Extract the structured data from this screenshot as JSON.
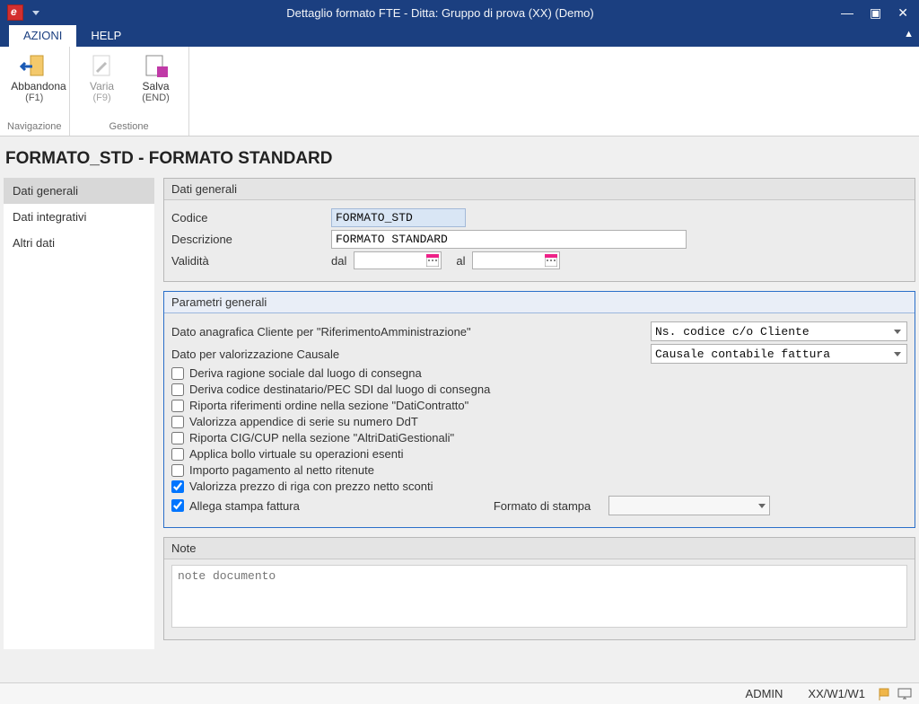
{
  "window": {
    "title": "Dettaglio formato FTE - Ditta: Gruppo di prova (XX)  (Demo)"
  },
  "tabs": {
    "azioni": "AZIONI",
    "help": "HELP"
  },
  "ribbon": {
    "abbandona_label": "Abbandona",
    "abbandona_sub": "(F1)",
    "varia_label": "Varia",
    "varia_sub": "(F9)",
    "salva_label": "Salva",
    "salva_sub": "(END)",
    "group_nav": "Navigazione",
    "group_gest": "Gestione"
  },
  "page_heading": "FORMATO_STD - FORMATO STANDARD",
  "sidenav": {
    "dati_generali": "Dati generali",
    "dati_integrativi": "Dati integrativi",
    "altri_dati": "Altri dati"
  },
  "panel_general": {
    "title": "Dati generali",
    "codice_label": "Codice",
    "codice_value": "FORMATO_STD",
    "descrizione_label": "Descrizione",
    "descrizione_value": "FORMATO STANDARD",
    "validita_label": "Validità",
    "dal_label": "dal",
    "al_label": "al"
  },
  "panel_param": {
    "title": "Parametri generali",
    "row_rif_label": "Dato anagrafica Cliente per \"RiferimentoAmministrazione\"",
    "row_rif_select": "Ns. codice c/o Cliente",
    "row_causale_label": "Dato per valorizzazione Causale",
    "row_causale_select": "Causale contabile fattura",
    "chk1": "Deriva ragione sociale dal luogo di consegna",
    "chk2": "Deriva codice destinatario/PEC SDI dal luogo di consegna",
    "chk3": "Riporta riferimenti ordine nella sezione \"DatiContratto\"",
    "chk4": "Valorizza appendice di serie su numero DdT",
    "chk5": "Riporta CIG/CUP nella sezione \"AltriDatiGestionali\"",
    "chk6": "Applica bollo virtuale su operazioni esenti",
    "chk7": "Importo pagamento al netto ritenute",
    "chk8": "Valorizza prezzo di riga con prezzo netto sconti",
    "chk9": "Allega stampa fattura",
    "formato_stampa_label": "Formato di stampa"
  },
  "panel_note": {
    "title": "Note",
    "placeholder": "note documento"
  },
  "statusbar": {
    "user": "ADMIN",
    "path": "XX/W1/W1"
  }
}
